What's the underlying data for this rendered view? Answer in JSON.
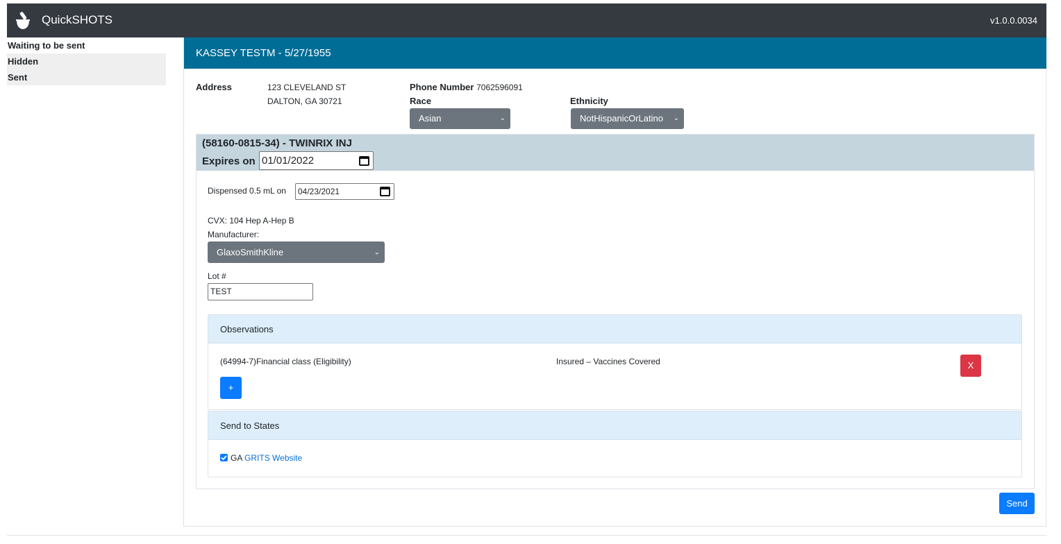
{
  "app": {
    "title": "QuickSHOTS",
    "version": "v1.0.0.0034"
  },
  "sidebar": {
    "items": [
      {
        "label": "Waiting to be sent"
      },
      {
        "label": "Hidden"
      },
      {
        "label": "Sent"
      }
    ]
  },
  "patient": {
    "header": "KASSEY TESTM - 5/27/1955",
    "address_label": "Address",
    "address_line1": "123 CLEVELAND ST",
    "address_line2": "DALTON, GA 30721",
    "phone_label": "Phone Number",
    "phone": "7062596091",
    "race_label": "Race",
    "race_value": "Asian",
    "ethnicity_label": "Ethnicity",
    "ethnicity_value": "NotHispanicOrLatino"
  },
  "vaccine": {
    "title": "(58160-0815-34) - TWINRIX INJ",
    "expires_label": "Expires on",
    "expires_value": "01/01/2022",
    "dispensed_label": "Dispensed 0.5 mL on",
    "dispensed_value": "04/23/2021",
    "cvx": "CVX: 104 Hep A-Hep B",
    "manufacturer_label": "Manufacturer:",
    "manufacturer_value": "GlaxoSmithKline",
    "lot_label": "Lot #",
    "lot_value": "TEST"
  },
  "observations": {
    "title": "Observations",
    "rows": [
      {
        "code": "(64994-7)Financial class (Eligibility)",
        "value": "Insured – Vaccines Covered",
        "remove_label": "X"
      }
    ],
    "add_label": "+"
  },
  "states": {
    "title": "Send to States",
    "items": [
      {
        "state": "GA",
        "link": "GRITS Website",
        "checked": true
      }
    ]
  },
  "actions": {
    "send_label": "Send"
  },
  "colors": {
    "navbar": "#343a40",
    "header": "#006d96",
    "primary": "#0b7bff",
    "danger": "#dc3545",
    "select": "#6c757d",
    "link": "#0b6fd6"
  }
}
